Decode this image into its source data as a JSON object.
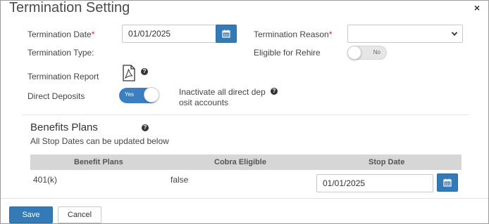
{
  "dialog": {
    "title": "Termination Setting",
    "close_label": "×"
  },
  "form": {
    "termination_date_label": "Termination Date",
    "termination_date_value": "01/01/2025",
    "termination_reason_label": "Termination Reason",
    "termination_reason_value": "",
    "termination_type_label": "Termination Type:",
    "eligible_rehire_label": "Eligible for Rehire",
    "eligible_rehire_toggle": "No",
    "termination_report_label": "Termination Report",
    "direct_deposits_label": "Direct Deposits",
    "direct_deposits_toggle": "Yes",
    "inactivate_line1": "Inactivate all direct dep",
    "inactivate_line2": "osit accounts",
    "required_mark": "*",
    "help_glyph": "?"
  },
  "benefits": {
    "title": "Benefits Plans",
    "subtitle": "All Stop Dates can be updated below",
    "columns": [
      "Benefit Plans",
      "Cobra Eligible",
      "Stop Date"
    ],
    "rows": [
      {
        "plan": "401(k)",
        "cobra": "false",
        "stop_date": "01/01/2025"
      }
    ]
  },
  "footer": {
    "save_label": "Save",
    "cancel_label": "Cancel"
  },
  "icons": {
    "calendar": "calendar-icon",
    "pdf": "pdf-icon",
    "help": "help-icon",
    "chevron": "chevron-down-icon"
  },
  "colors": {
    "primary": "#337ab7",
    "required": "#c9302c",
    "toggle_on": "#3a7fc1"
  }
}
